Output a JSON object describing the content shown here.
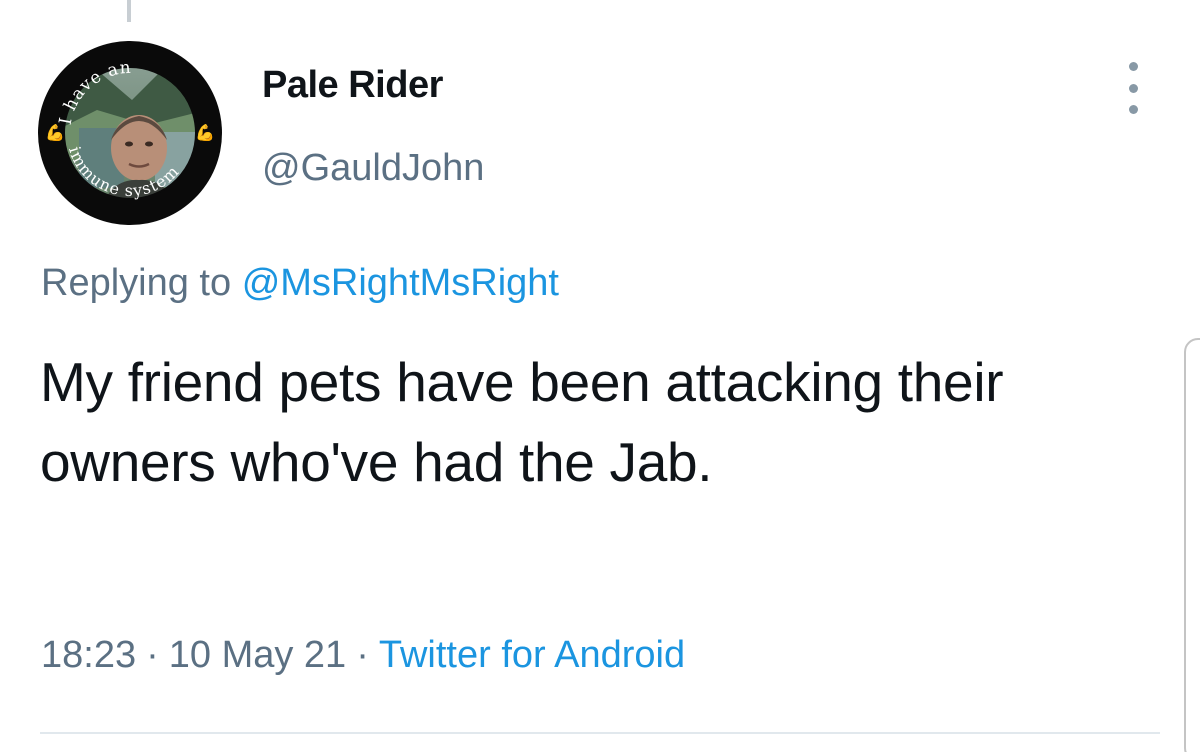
{
  "user": {
    "display_name": "Pale Rider",
    "handle": "@GauldJohn",
    "avatar_badge_text": "I have an immune system"
  },
  "reply": {
    "prefix": "Replying to",
    "mention": "@MsRightMsRight"
  },
  "tweet": {
    "text": "My friend pets have been attacking their owners who've had the Jab."
  },
  "meta": {
    "time": "18:23",
    "date": "10 May 21",
    "separator": "·",
    "source": "Twitter for Android"
  },
  "icons": {
    "more": "more-vertical-icon"
  },
  "colors": {
    "text_primary": "#0f1419",
    "text_secondary": "#5b7083",
    "link": "#1b95e0",
    "divider": "#e1e8ed"
  }
}
